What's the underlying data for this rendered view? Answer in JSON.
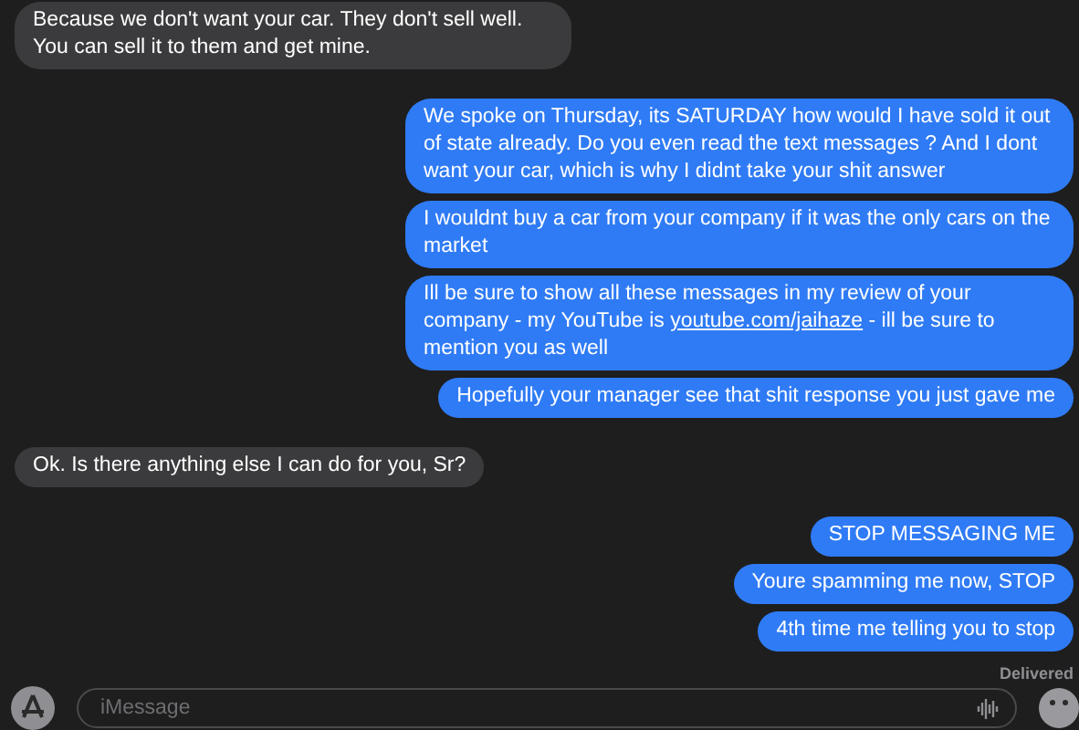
{
  "messages": [
    {
      "kind": "received",
      "parts": [
        {
          "kind": "text",
          "text": "Because we don't want your car. They don't sell well. You can sell it to them and get mine."
        }
      ]
    },
    {
      "kind": "sent",
      "parts": [
        {
          "kind": "text",
          "text": "We spoke on Thursday, its SATURDAY how would I have sold it out of state already. Do you even read the text messages ? And I dont want your car, which is why I didnt take your shit answer"
        }
      ]
    },
    {
      "kind": "sent",
      "parts": [
        {
          "kind": "text",
          "text": "I wouldnt buy a car from your company if it was the only cars on the market"
        }
      ]
    },
    {
      "kind": "sent",
      "parts": [
        {
          "kind": "text",
          "text": "Ill be sure to show all these messages in my review of your company - my YouTube is "
        },
        {
          "kind": "link",
          "text": "youtube.com/jaihaze"
        },
        {
          "kind": "text",
          "text": " - ill be sure to mention you as well"
        }
      ]
    },
    {
      "kind": "sent",
      "parts": [
        {
          "kind": "text",
          "text": "Hopefully your manager see that shit response you just gave me"
        }
      ]
    },
    {
      "kind": "received",
      "parts": [
        {
          "kind": "text",
          "text": "Ok. Is there anything else I can do for you, Sr?"
        }
      ]
    },
    {
      "kind": "sent",
      "parts": [
        {
          "kind": "text",
          "text": "STOP MESSAGING ME"
        }
      ]
    },
    {
      "kind": "sent",
      "parts": [
        {
          "kind": "text",
          "text": "Youre spamming me now, STOP"
        }
      ]
    },
    {
      "kind": "sent",
      "parts": [
        {
          "kind": "text",
          "text": "4th time me telling you to stop"
        }
      ]
    }
  ],
  "status": "Delivered",
  "composer": {
    "placeholder": "iMessage"
  }
}
